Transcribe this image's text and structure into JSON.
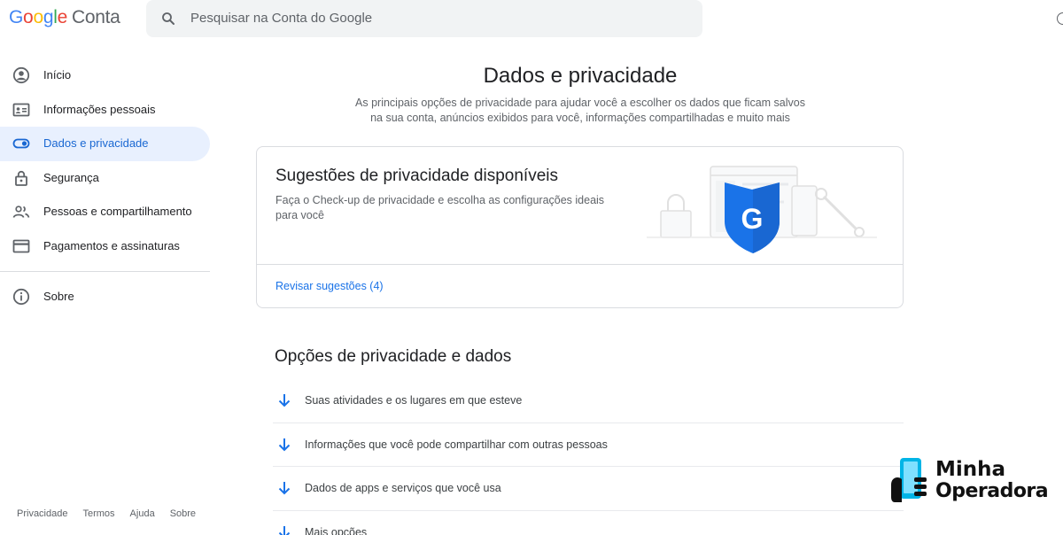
{
  "header": {
    "logo_google": "Google",
    "logo_product": "Conta",
    "search_placeholder": "Pesquisar na Conta do Google",
    "search_icon": "search-icon"
  },
  "sidebar": {
    "items": [
      {
        "label": "Início",
        "icon": "account-circle-icon"
      },
      {
        "label": "Informações pessoais",
        "icon": "id-card-icon"
      },
      {
        "label": "Dados e privacidade",
        "icon": "toggle-icon",
        "active": true
      },
      {
        "label": "Segurança",
        "icon": "lock-icon"
      },
      {
        "label": "Pessoas e compartilhamento",
        "icon": "people-icon"
      },
      {
        "label": "Pagamentos e assinaturas",
        "icon": "credit-card-icon"
      }
    ],
    "about": {
      "label": "Sobre",
      "icon": "info-icon"
    },
    "footer_links": [
      "Privacidade",
      "Termos",
      "Ajuda",
      "Sobre"
    ]
  },
  "main": {
    "title": "Dados e privacidade",
    "subtitle_line1": "As principais opções de privacidade para ajudar você a escolher os dados que ficam salvos",
    "subtitle_line2": "na sua conta, anúncios exibidos para você, informações compartilhadas e muito mais",
    "suggestions_card": {
      "title": "Sugestões de privacidade disponíveis",
      "description": "Faça o Check-up de privacidade e escolha as configurações ideais para você",
      "link": "Revisar sugestões (4)",
      "shield_letter": "G"
    },
    "options_section": {
      "title": "Opções de privacidade e dados",
      "items": [
        "Suas atividades e os lugares em que esteve",
        "Informações que você pode compartilhar com outras pessoas",
        "Dados de apps e serviços que você usa",
        "Mais opções"
      ]
    }
  },
  "watermark": {
    "line1": "Minha",
    "line2": "Operadora"
  },
  "colors": {
    "accent": "#1a73e8",
    "active_bg": "#e8f0fe",
    "shield": "#1a73e8"
  }
}
